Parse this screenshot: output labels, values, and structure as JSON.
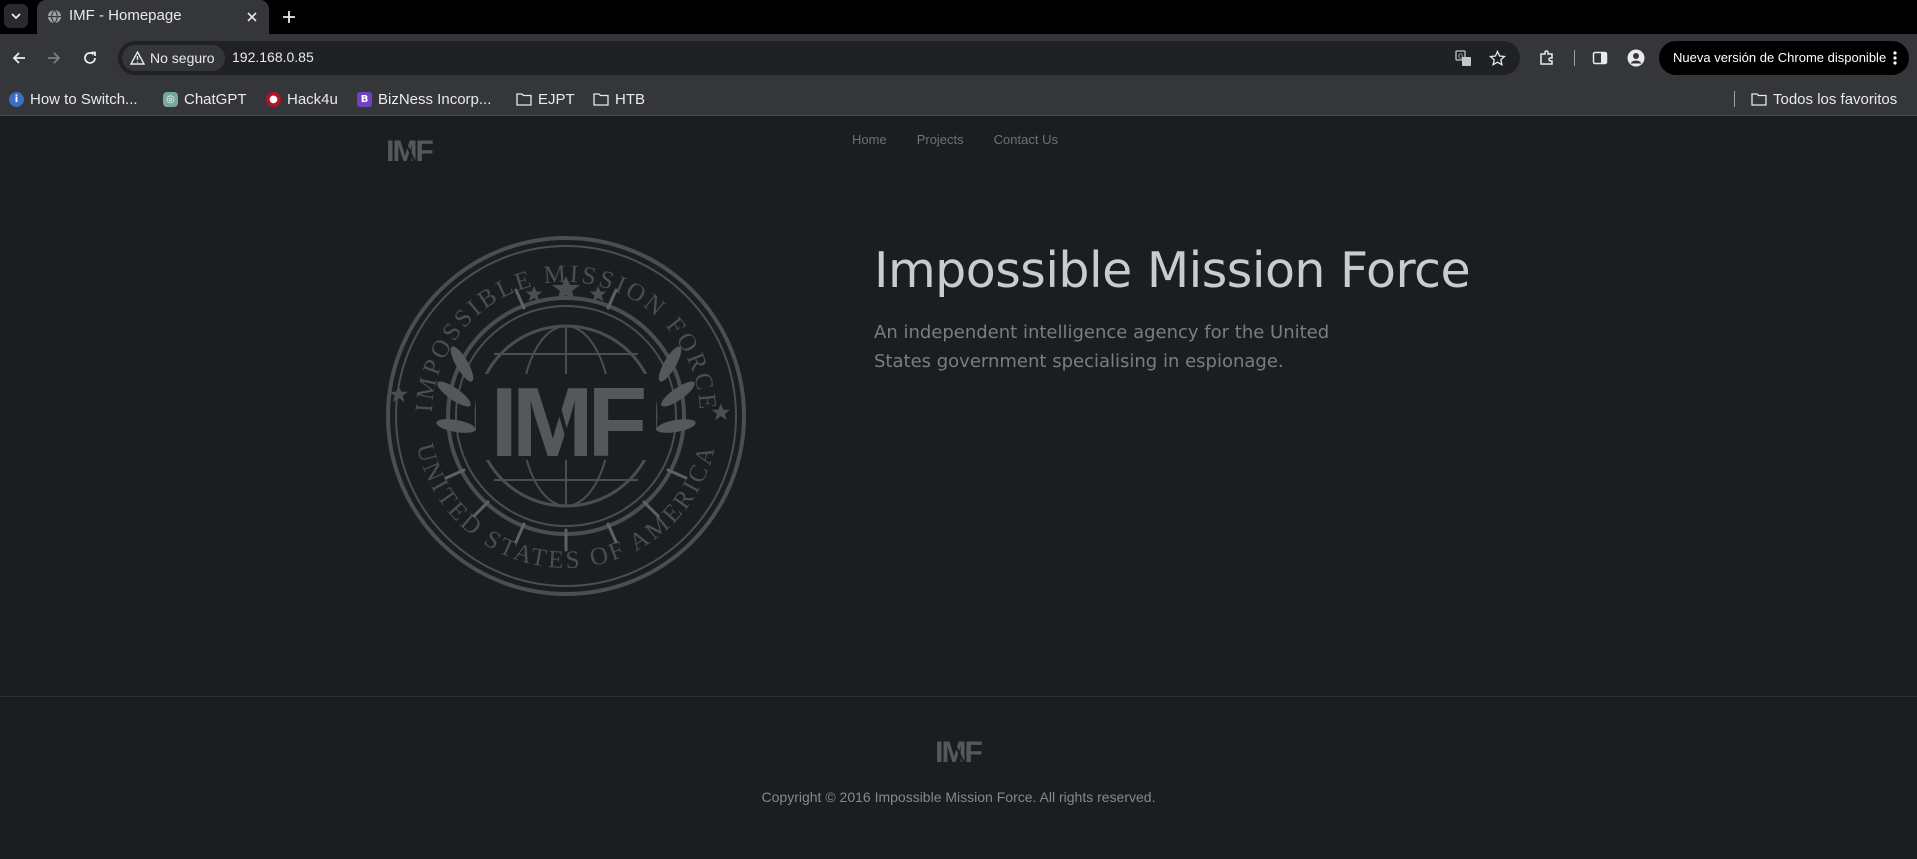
{
  "browser": {
    "tab": {
      "title": "IMF - Homepage",
      "favicon": "globe-icon"
    },
    "security_label": "No seguro",
    "url": "192.168.0.85",
    "update_label": "Nueva versión de Chrome disponible",
    "bookmarks": [
      {
        "label": "How to Switch...",
        "icon": "site-favicon"
      },
      {
        "label": "ChatGPT",
        "icon": "chatgpt-favicon"
      },
      {
        "label": "Hack4u",
        "icon": "hack4u-favicon"
      },
      {
        "label": "BizNess Incorp...",
        "icon": "bootstrap-favicon"
      },
      {
        "label": "EJPT",
        "icon": "folder-icon"
      },
      {
        "label": "HTB",
        "icon": "folder-icon"
      }
    ],
    "all_bookmarks_label": "Todos los favoritos"
  },
  "site": {
    "logo_text": "IMF",
    "nav": [
      "Home",
      "Projects",
      "Contact Us"
    ],
    "hero": {
      "title": "Impossible Mission Force",
      "subtitle": "An independent intelligence agency for the United States government specialising in espionage."
    },
    "seal": {
      "top_text": "IMPOSSIBLE MISSION FORCE",
      "bottom_text": "UNITED STATES OF AMERICA",
      "center_text": "IMF"
    },
    "footer": {
      "copyright": "Copyright © 2016 Impossible Mission Force. All rights reserved."
    }
  },
  "colors": {
    "page_background": "#1b1d1f",
    "browser_chrome": "#35363a",
    "seal": "#4b4d50"
  }
}
